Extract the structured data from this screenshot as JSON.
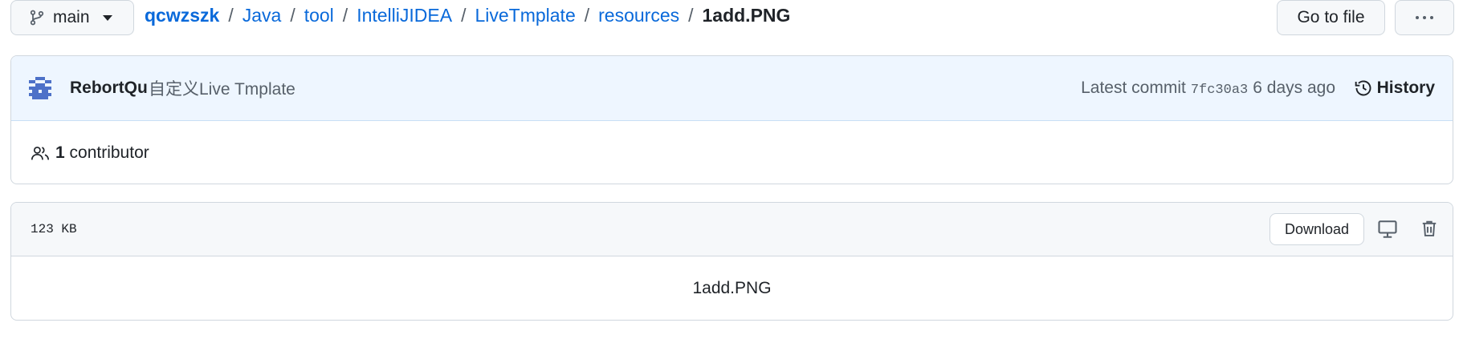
{
  "branch": {
    "icon": "git-branch-icon",
    "name": "main"
  },
  "breadcrumb": {
    "repo": "qcwzszk",
    "separator": "/",
    "dirs": [
      "Java",
      "tool",
      "IntelliJIDEA",
      "LiveTmplate",
      "resources"
    ],
    "file": "1add.PNG"
  },
  "toolbar": {
    "goto_label": "Go to file",
    "more_icon": "kebab-horizontal-icon"
  },
  "commit": {
    "author": "RebortQu",
    "message": "自定义Live Tmplate",
    "latest_label": "Latest commit",
    "sha": "7fc30a3",
    "time": "6 days ago",
    "history_label": "History"
  },
  "contributors": {
    "count": "1",
    "label": "contributor"
  },
  "file": {
    "size": "123 KB",
    "download_label": "Download",
    "display_name": "1add.PNG"
  },
  "colors": {
    "link": "#0969da",
    "commit_bg": "#eef6ff",
    "border": "#d0d7de",
    "avatar": "#4d71c8"
  }
}
